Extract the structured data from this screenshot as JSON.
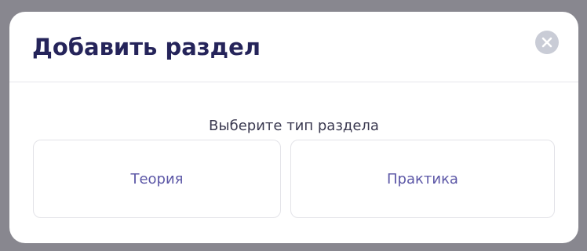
{
  "modal": {
    "title": "Добавить раздел",
    "close_icon": "close-icon",
    "subtitle": "Выберите тип раздела",
    "options": [
      {
        "label": "Теория"
      },
      {
        "label": "Практика"
      }
    ]
  },
  "colors": {
    "overlay": "#88878f",
    "title": "#25245a",
    "accent": "#5b56a6",
    "close_bg": "#c9ccd6"
  }
}
